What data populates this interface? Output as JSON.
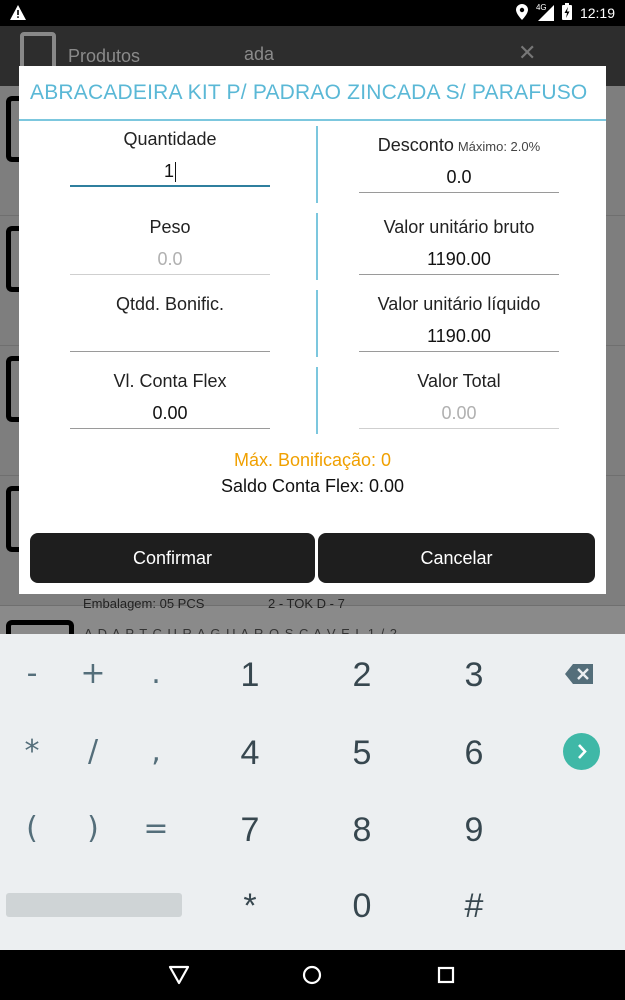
{
  "status_bar": {
    "network": "4G",
    "time": "12:19"
  },
  "background": {
    "toolbar_title": "Produtos",
    "search_text": "ada",
    "row_text_1": "Embalagem: 05 PCS",
    "row_text_2": "2 - TOK D - 7",
    "partial_text": "A D A P T  C U R  A G U A  R O S C A V E L  1 / 2"
  },
  "dialog": {
    "title": "ABRACADEIRA KIT P/ PADRAO ZINCADA S/ PARAFUSO",
    "fields": {
      "quantidade": {
        "label": "Quantidade",
        "value": "1"
      },
      "desconto": {
        "label": "Desconto",
        "max_label": "Máximo: 2.0%",
        "value": "0.0"
      },
      "peso": {
        "label": "Peso",
        "value": "0.0"
      },
      "valor_unitario_bruto": {
        "label": "Valor unitário bruto",
        "value": "1190.00"
      },
      "qtdd_bonific": {
        "label": "Qtdd. Bonific.",
        "value": ""
      },
      "valor_unitario_liquido": {
        "label": "Valor unitário líquido",
        "value": "1190.00"
      },
      "vl_conta_flex": {
        "label": "Vl. Conta Flex",
        "value": "0.00"
      },
      "valor_total": {
        "label": "Valor Total",
        "value": "0.00"
      }
    },
    "max_bonificacao": "Máx. Bonificação: 0",
    "saldo_conta_flex": "Saldo Conta Flex: 0.00",
    "confirm_label": "Confirmar",
    "cancel_label": "Cancelar"
  },
  "keyboard": {
    "rows": [
      [
        "-",
        "+",
        ".",
        "1",
        "2",
        "3"
      ],
      [
        "*",
        "/",
        ",",
        "4",
        "5",
        "6"
      ],
      [
        "(",
        ")",
        "=",
        "7",
        "8",
        "9"
      ],
      [
        "*",
        "0",
        "#"
      ]
    ]
  },
  "colors": {
    "accent": "#5ab8d6",
    "warning": "#f0a000",
    "enter": "#3fb8a7",
    "button": "#1e1e1e"
  }
}
